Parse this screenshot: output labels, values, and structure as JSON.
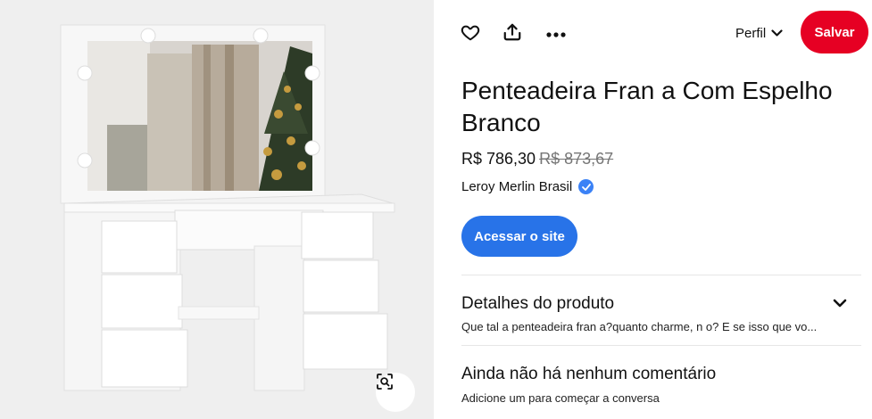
{
  "product": {
    "title": "Penteadeira Fran a Com Espelho Branco",
    "price": "R$ 786,30",
    "old_price": "R$ 873,67",
    "seller": "Leroy Merlin Brasil",
    "visit_label": "Acessar o site"
  },
  "header": {
    "profile_label": "Perfil",
    "save_label": "Salvar"
  },
  "details": {
    "title": "Detalhes do produto",
    "summary": "Que tal a penteadeira fran a?quanto charme, n o? E se isso que vo..."
  },
  "comments": {
    "title": "Ainda não há nenhum comentário",
    "prompt": "Adicione um para começar a conversa"
  },
  "icons": {
    "like": "heart-icon",
    "share": "share-icon",
    "more": "more-icon",
    "profile_dropdown": "chevron-down-icon",
    "verified": "verified-badge-icon",
    "lens": "visual-search-icon"
  },
  "colors": {
    "save": "#e60023",
    "visit": "#2873e8",
    "verified": "#3b82f6"
  }
}
